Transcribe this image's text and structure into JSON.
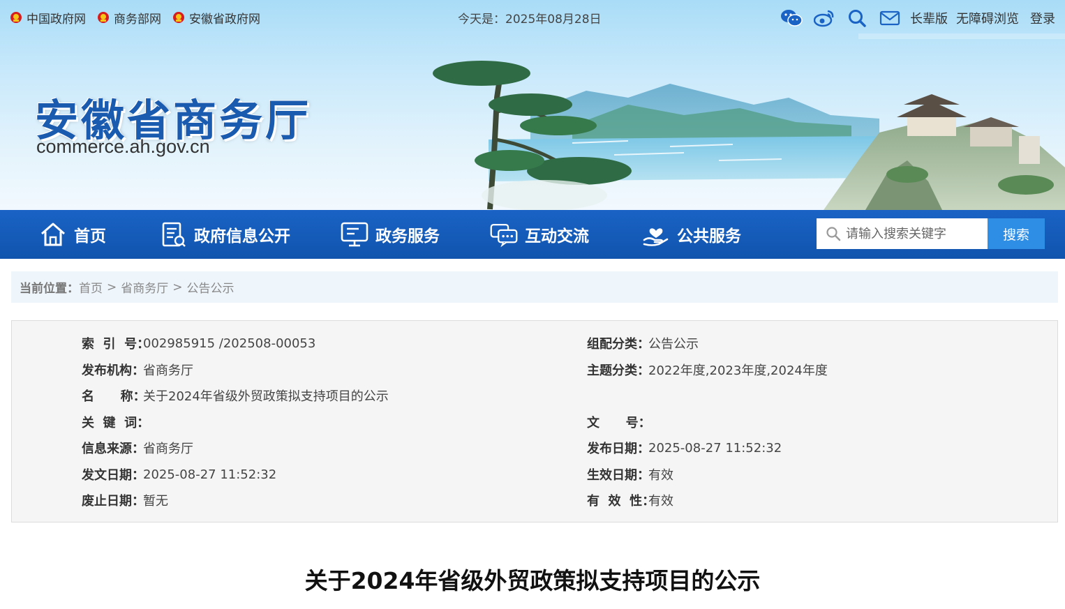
{
  "top_links": [
    {
      "label": "中国政府网"
    },
    {
      "label": "商务部网"
    },
    {
      "label": "安徽省政府网"
    }
  ],
  "today": {
    "prefix": "今天是：",
    "date": "2025年08月28日"
  },
  "tools": {
    "elder_version": "长辈版",
    "accessible": "无障碍浏览",
    "login": "登录"
  },
  "site": {
    "title": "安徽省商务厅",
    "domain": "commerce.ah.gov.cn"
  },
  "nav": {
    "items": [
      {
        "label": "首页",
        "icon": "home-icon"
      },
      {
        "label": "政府信息公开",
        "icon": "document-list-icon"
      },
      {
        "label": "政务服务",
        "icon": "monitor-icon"
      },
      {
        "label": "互动交流",
        "icon": "chat-icon"
      },
      {
        "label": "公共服务",
        "icon": "hand-heart-icon"
      }
    ],
    "search_placeholder": "请输入搜索关键字",
    "search_button": "搜索"
  },
  "breadcrumb": {
    "label": "当前位置：",
    "items": [
      "首页",
      "省商务厅",
      "公告公示"
    ],
    "separator": ">"
  },
  "info": {
    "index_label": "索  引  号：",
    "index_value": "002985915 /202508-00053",
    "category_label": "组配分类：",
    "category_value": "公告公示",
    "publisher_label": "发布机构：",
    "publisher_value": "省商务厅",
    "topic_label": "主题分类：",
    "topic_value": "2022年度,2023年度,2024年度",
    "name_label": "名      称：",
    "name_value": "关于2024年省级外贸政策拟支持项目的公示",
    "keywords_label": "关  键  词：",
    "keywords_value": "",
    "doc_no_label": "文      号：",
    "doc_no_value": "",
    "source_label": "信息来源：",
    "source_value": "省商务厅",
    "pub_date_label": "发布日期：",
    "pub_date_value": "2025-08-27 11:52:32",
    "issue_date_label": "发文日期：",
    "issue_date_value": "2025-08-27 11:52:32",
    "effective_date_label": "生效日期：",
    "effective_date_value": "有效",
    "repeal_date_label": "废止日期：",
    "repeal_date_value": "暂无",
    "validity_label": "有  效  性：",
    "validity_value": "有效"
  },
  "article": {
    "title": "关于2024年省级外贸政策拟支持项目的公示"
  },
  "colors": {
    "nav_blue": "#1a63c5",
    "title_blue": "#1a5bb0",
    "search_button": "#2e8ee6",
    "emblem_red": "#d61e1e"
  }
}
